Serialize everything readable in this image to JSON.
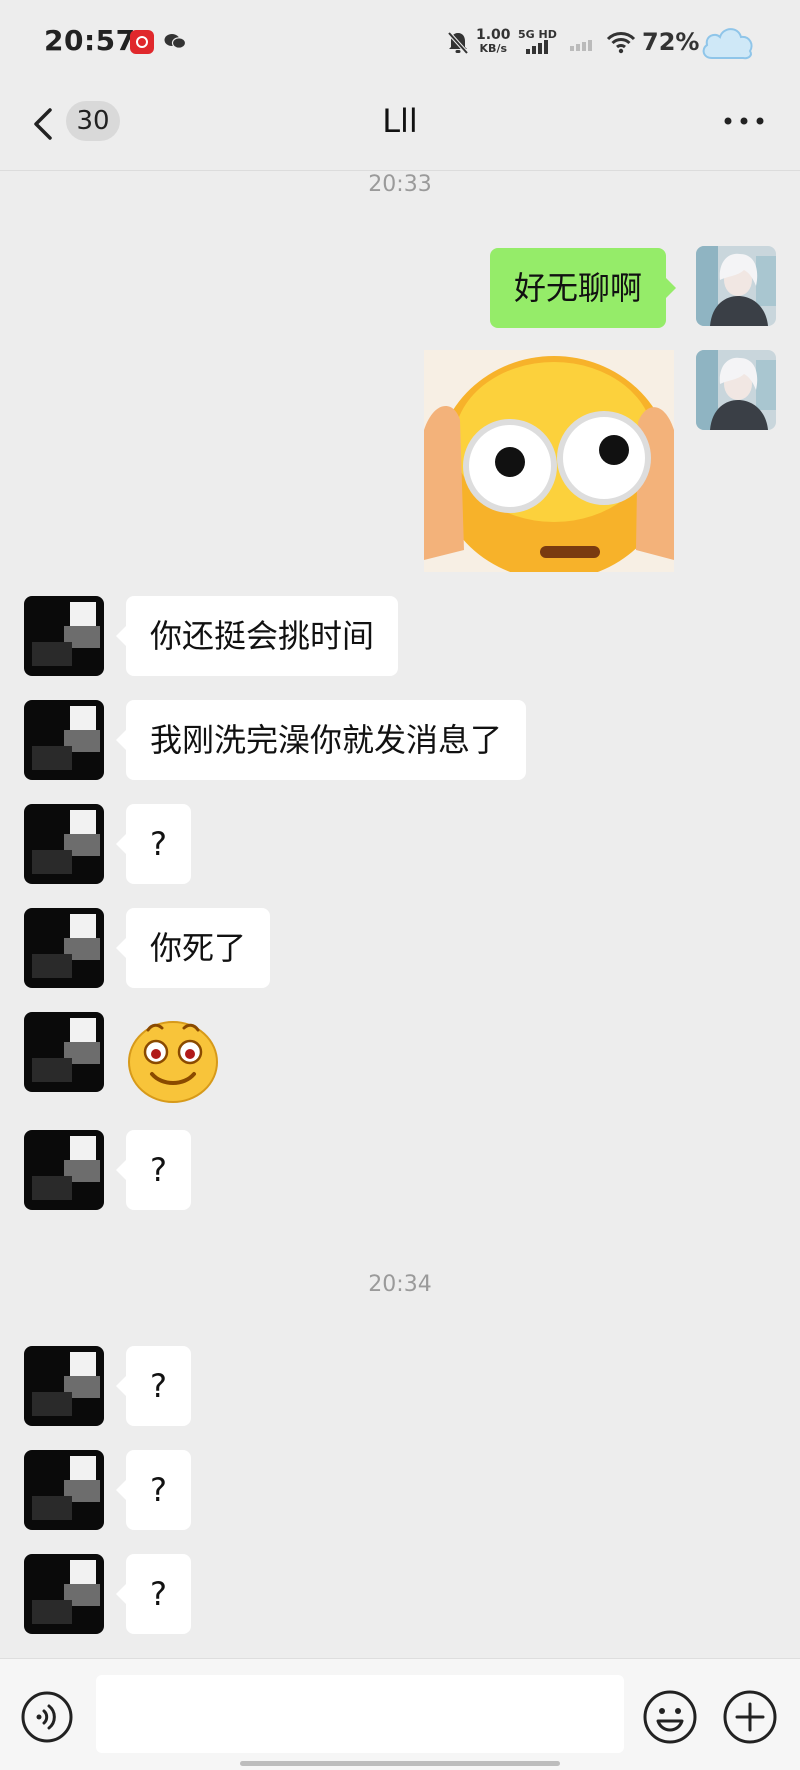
{
  "status_bar": {
    "time": "20:57",
    "net_speed_value": "1.00",
    "net_speed_unit": "KB/s",
    "network_type": "5G HD",
    "battery_percent": "72%",
    "icons": [
      "netease-music-icon",
      "wechat-notify-icon",
      "mute-bell-icon",
      "signal-icon",
      "wifi-icon",
      "cloud-icon"
    ]
  },
  "header": {
    "back_label": "<",
    "unread_count": "30",
    "title": "Lll",
    "more_label": "···"
  },
  "timestamps": [
    "20:33",
    "20:34"
  ],
  "messages": [
    {
      "sender": "me",
      "type": "text",
      "text": "好无聊啊"
    },
    {
      "sender": "me",
      "type": "sticker",
      "sticker": "shocked-face-sticker"
    },
    {
      "sender": "other",
      "type": "text",
      "text": "你还挺会挑时间"
    },
    {
      "sender": "other",
      "type": "text",
      "text": "我刚洗完澡你就发消息了"
    },
    {
      "sender": "other",
      "type": "text",
      "text": "?"
    },
    {
      "sender": "other",
      "type": "text",
      "text": "你死了"
    },
    {
      "sender": "other",
      "type": "emoji",
      "emoji": "smile-emoji"
    },
    {
      "sender": "other",
      "type": "text",
      "text": "?"
    },
    {
      "sender": "other",
      "type": "text",
      "text": "?"
    },
    {
      "sender": "other",
      "type": "text",
      "text": "?"
    },
    {
      "sender": "other",
      "type": "text",
      "text": "?"
    }
  ],
  "input_bar": {
    "icons": [
      "voice-icon",
      "emoji-icon",
      "plus-icon"
    ],
    "input_value": ""
  },
  "colors": {
    "background": "#ededed",
    "my_bubble": "#95ec69",
    "other_bubble": "#ffffff",
    "timestamp": "#9a9a9a"
  }
}
